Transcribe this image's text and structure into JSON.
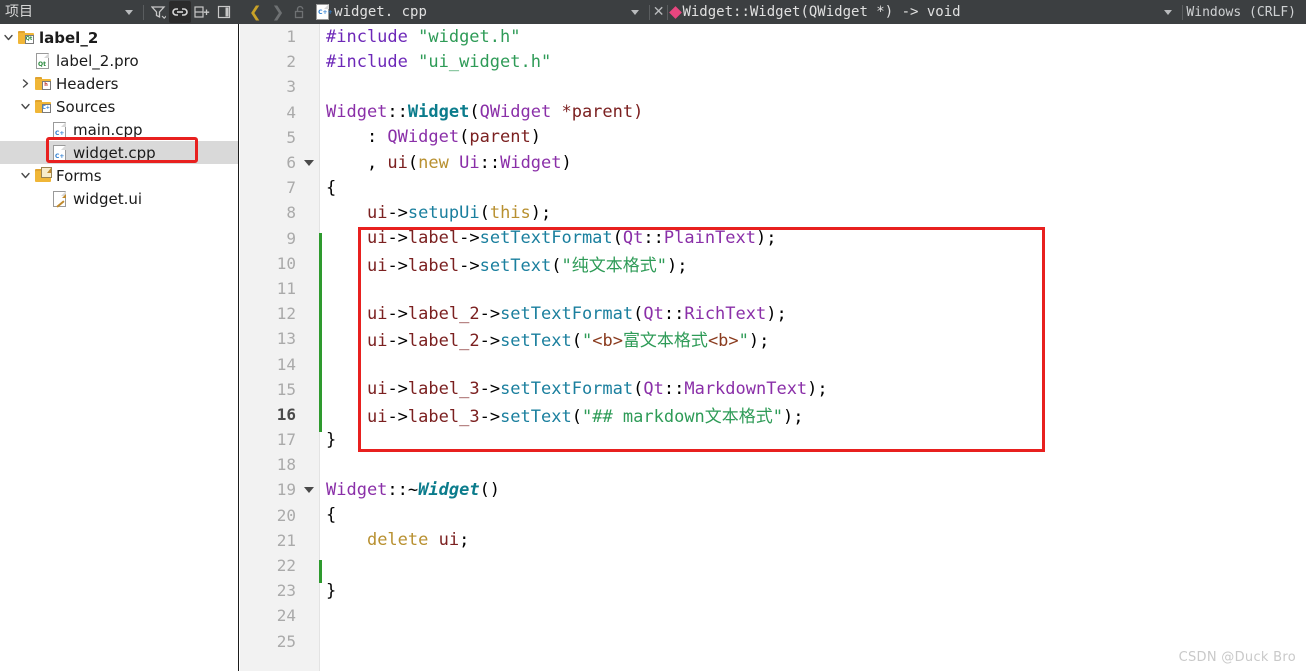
{
  "topbar": {
    "project_label": "项目",
    "icons": [
      {
        "name": "chevron-down-icon",
        "glyph": "▾"
      },
      {
        "name": "filter-icon",
        "glyph": "filter"
      },
      {
        "name": "link-sync-icon",
        "glyph": "link"
      },
      {
        "name": "split-add-icon",
        "glyph": "split"
      },
      {
        "name": "close-pane-icon",
        "glyph": "closepane"
      }
    ],
    "nav_back": "❮",
    "nav_forward": "❯",
    "lock_icon": "unlocked-icon",
    "file_icon_label": "C++",
    "file_name": "widget. cpp",
    "file_dropdown": "▾",
    "close_label": "✕",
    "symbol_name": "Widget::Widget(QWidget *) -> void",
    "symbol_dropdown": "▾",
    "eol_label": "Windows  (CRLF)"
  },
  "sidebar": {
    "items": [
      {
        "depth": 0,
        "twisty": "v",
        "icon": "folder-qt",
        "label": "label_2",
        "bold": true,
        "selected": false
      },
      {
        "depth": 1,
        "twisty": "",
        "icon": "file-pro",
        "label": "label_2.pro",
        "bold": false,
        "selected": false
      },
      {
        "depth": 1,
        "twisty": ">",
        "icon": "folder-h",
        "label": "Headers",
        "bold": false,
        "selected": false
      },
      {
        "depth": 1,
        "twisty": "v",
        "icon": "folder-cpp",
        "label": "Sources",
        "bold": false,
        "selected": false
      },
      {
        "depth": 2,
        "twisty": "",
        "icon": "file-cpp",
        "label": "main.cpp",
        "bold": false,
        "selected": false
      },
      {
        "depth": 2,
        "twisty": "",
        "icon": "file-cpp",
        "label": "widget.cpp",
        "bold": false,
        "selected": true
      },
      {
        "depth": 1,
        "twisty": "v",
        "icon": "folder-ui",
        "label": "Forms",
        "bold": false,
        "selected": false
      },
      {
        "depth": 2,
        "twisty": "",
        "icon": "file-ui",
        "label": "widget.ui",
        "bold": false,
        "selected": false
      }
    ],
    "selection_highlight_color": "#e8201f"
  },
  "editor": {
    "current_line": 16,
    "change_bar_color": "#2e9a2e",
    "change_bar_ranges": [
      [
        9,
        16
      ],
      [
        22,
        22
      ]
    ],
    "fold_markers": [
      6,
      19
    ],
    "highlight_box_color": "#e8201f",
    "highlight_box_lines": [
      9,
      16
    ],
    "lines": [
      {
        "n": 1,
        "tokens": [
          {
            "t": "#include ",
            "c": "t-pre"
          },
          {
            "t": "\"widget.h\"",
            "c": "t-str"
          }
        ]
      },
      {
        "n": 2,
        "tokens": [
          {
            "t": "#include ",
            "c": "t-pre"
          },
          {
            "t": "\"ui_widget.h\"",
            "c": "t-str"
          }
        ]
      },
      {
        "n": 3,
        "tokens": []
      },
      {
        "n": 4,
        "tokens": [
          {
            "t": "Widget",
            "c": "t-type"
          },
          {
            "t": "::",
            "c": "t-op"
          },
          {
            "t": "Widget",
            "c": "t-cls"
          },
          {
            "t": "(",
            "c": "t-op"
          },
          {
            "t": "QWidget",
            "c": "t-type"
          },
          {
            "t": " *parent)",
            "c": "t-var"
          }
        ]
      },
      {
        "n": 5,
        "tokens": [
          {
            "t": "    : ",
            "c": "t-op"
          },
          {
            "t": "QWidget",
            "c": "t-type"
          },
          {
            "t": "(",
            "c": "t-op"
          },
          {
            "t": "parent",
            "c": "t-var"
          },
          {
            "t": ")",
            "c": "t-op"
          }
        ]
      },
      {
        "n": 6,
        "tokens": [
          {
            "t": "    , ",
            "c": "t-op"
          },
          {
            "t": "ui",
            "c": "t-var"
          },
          {
            "t": "(",
            "c": "t-op"
          },
          {
            "t": "new",
            "c": "t-kw"
          },
          {
            "t": " ",
            "c": "t-op"
          },
          {
            "t": "Ui",
            "c": "t-type"
          },
          {
            "t": "::",
            "c": "t-op"
          },
          {
            "t": "Widget",
            "c": "t-type"
          },
          {
            "t": ")",
            "c": "t-op"
          }
        ]
      },
      {
        "n": 7,
        "tokens": [
          {
            "t": "{",
            "c": "t-op"
          }
        ]
      },
      {
        "n": 8,
        "tokens": [
          {
            "t": "    ",
            "c": "t-op"
          },
          {
            "t": "ui",
            "c": "t-var"
          },
          {
            "t": "->",
            "c": "t-op"
          },
          {
            "t": "setupUi",
            "c": "t-fn"
          },
          {
            "t": "(",
            "c": "t-op"
          },
          {
            "t": "this",
            "c": "t-kw"
          },
          {
            "t": ");",
            "c": "t-op"
          }
        ]
      },
      {
        "n": 9,
        "tokens": [
          {
            "t": "    ",
            "c": "t-op"
          },
          {
            "t": "ui",
            "c": "t-var"
          },
          {
            "t": "->",
            "c": "t-op"
          },
          {
            "t": "label",
            "c": "t-var"
          },
          {
            "t": "->",
            "c": "t-op"
          },
          {
            "t": "setTextFormat",
            "c": "t-fn"
          },
          {
            "t": "(",
            "c": "t-op"
          },
          {
            "t": "Qt",
            "c": "t-ns"
          },
          {
            "t": "::",
            "c": "t-op"
          },
          {
            "t": "PlainText",
            "c": "t-ns"
          },
          {
            "t": ");",
            "c": "t-op"
          }
        ]
      },
      {
        "n": 10,
        "tokens": [
          {
            "t": "    ",
            "c": "t-op"
          },
          {
            "t": "ui",
            "c": "t-var"
          },
          {
            "t": "->",
            "c": "t-op"
          },
          {
            "t": "label",
            "c": "t-var"
          },
          {
            "t": "->",
            "c": "t-op"
          },
          {
            "t": "setText",
            "c": "t-fn"
          },
          {
            "t": "(",
            "c": "t-op"
          },
          {
            "t": "\"纯文本格式\"",
            "c": "t-str"
          },
          {
            "t": ");",
            "c": "t-op"
          }
        ]
      },
      {
        "n": 11,
        "tokens": []
      },
      {
        "n": 12,
        "tokens": [
          {
            "t": "    ",
            "c": "t-op"
          },
          {
            "t": "ui",
            "c": "t-var"
          },
          {
            "t": "->",
            "c": "t-op"
          },
          {
            "t": "label_2",
            "c": "t-var"
          },
          {
            "t": "->",
            "c": "t-op"
          },
          {
            "t": "setTextFormat",
            "c": "t-fn"
          },
          {
            "t": "(",
            "c": "t-op"
          },
          {
            "t": "Qt",
            "c": "t-ns"
          },
          {
            "t": "::",
            "c": "t-op"
          },
          {
            "t": "RichText",
            "c": "t-ns"
          },
          {
            "t": ");",
            "c": "t-op"
          }
        ]
      },
      {
        "n": 13,
        "tokens": [
          {
            "t": "    ",
            "c": "t-op"
          },
          {
            "t": "ui",
            "c": "t-var"
          },
          {
            "t": "->",
            "c": "t-op"
          },
          {
            "t": "label_2",
            "c": "t-var"
          },
          {
            "t": "->",
            "c": "t-op"
          },
          {
            "t": "setText",
            "c": "t-fn"
          },
          {
            "t": "(",
            "c": "t-op"
          },
          {
            "t": "\"",
            "c": "t-str"
          },
          {
            "t": "<b>",
            "c": "t-tag"
          },
          {
            "t": "富文本格式",
            "c": "t-str"
          },
          {
            "t": "<b>",
            "c": "t-tag"
          },
          {
            "t": "\"",
            "c": "t-str"
          },
          {
            "t": ");",
            "c": "t-op"
          }
        ]
      },
      {
        "n": 14,
        "tokens": []
      },
      {
        "n": 15,
        "tokens": [
          {
            "t": "    ",
            "c": "t-op"
          },
          {
            "t": "ui",
            "c": "t-var"
          },
          {
            "t": "->",
            "c": "t-op"
          },
          {
            "t": "label_3",
            "c": "t-var"
          },
          {
            "t": "->",
            "c": "t-op"
          },
          {
            "t": "setTextFormat",
            "c": "t-fn"
          },
          {
            "t": "(",
            "c": "t-op"
          },
          {
            "t": "Qt",
            "c": "t-ns"
          },
          {
            "t": "::",
            "c": "t-op"
          },
          {
            "t": "MarkdownText",
            "c": "t-ns"
          },
          {
            "t": ");",
            "c": "t-op"
          }
        ]
      },
      {
        "n": 16,
        "tokens": [
          {
            "t": "    ",
            "c": "t-op"
          },
          {
            "t": "ui",
            "c": "t-var"
          },
          {
            "t": "->",
            "c": "t-op"
          },
          {
            "t": "label_3",
            "c": "t-var"
          },
          {
            "t": "->",
            "c": "t-op"
          },
          {
            "t": "setText",
            "c": "t-fn"
          },
          {
            "t": "(",
            "c": "t-op"
          },
          {
            "t": "\"## markdown文本格式\"",
            "c": "t-str"
          },
          {
            "t": ");",
            "c": "t-op"
          }
        ]
      },
      {
        "n": 17,
        "tokens": [
          {
            "t": "}",
            "c": "t-op"
          }
        ]
      },
      {
        "n": 18,
        "tokens": []
      },
      {
        "n": 19,
        "tokens": [
          {
            "t": "Widget",
            "c": "t-type"
          },
          {
            "t": "::~",
            "c": "t-op"
          },
          {
            "t": "Widget",
            "c": "t-clsi"
          },
          {
            "t": "()",
            "c": "t-op"
          }
        ]
      },
      {
        "n": 20,
        "tokens": [
          {
            "t": "{",
            "c": "t-op"
          }
        ]
      },
      {
        "n": 21,
        "tokens": [
          {
            "t": "    ",
            "c": "t-op"
          },
          {
            "t": "delete",
            "c": "t-kw"
          },
          {
            "t": " ",
            "c": "t-op"
          },
          {
            "t": "ui",
            "c": "t-var"
          },
          {
            "t": ";",
            "c": "t-op"
          }
        ]
      },
      {
        "n": 22,
        "tokens": []
      },
      {
        "n": 23,
        "tokens": [
          {
            "t": "}",
            "c": "t-op"
          }
        ]
      },
      {
        "n": 24,
        "tokens": []
      },
      {
        "n": 25,
        "tokens": []
      }
    ]
  },
  "watermark": "CSDN @Duck Bro"
}
